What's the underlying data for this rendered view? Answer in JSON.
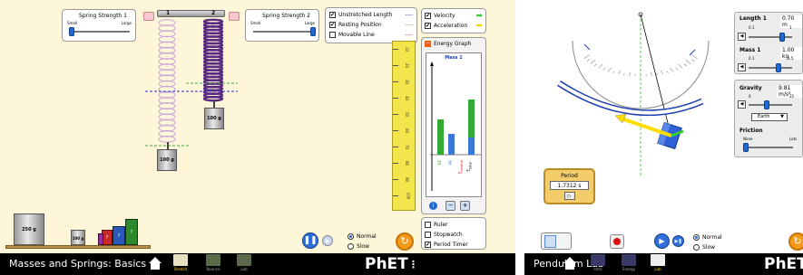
{
  "left_sim": {
    "title": "Masses and Springs: Basics",
    "spring_strength_1": {
      "label": "Spring Strength 1",
      "min_label": "Small",
      "max_label": "Large"
    },
    "spring_strength_2": {
      "label": "Spring Strength 2",
      "min_label": "Small",
      "max_label": "Large"
    },
    "spring_numbers": [
      "1",
      "2"
    ],
    "options": [
      {
        "label": "Unstretched Length",
        "checked": true
      },
      {
        "label": "Resting Position",
        "checked": true
      },
      {
        "label": "Movable Line",
        "checked": false
      }
    ],
    "attached_masses": [
      "100 g",
      "100 g"
    ],
    "shelf_masses": [
      "250 g",
      "100 g",
      "?",
      "?",
      "?",
      "?",
      "?"
    ],
    "ruler_marks": [
      "10",
      "20",
      "30",
      "40",
      "50",
      "60",
      "70",
      "80",
      "90",
      "100"
    ],
    "speed": {
      "normal": "Normal",
      "slow": "Slow",
      "selected": "Normal"
    },
    "screens": [
      "Stretch",
      "Bounce",
      "Lab"
    ],
    "active_screen": "Stretch",
    "brand": "PhET"
  },
  "middle_panel": {
    "vectors": [
      {
        "label": "Velocity",
        "checked": true,
        "arrow_color": "#33cc33"
      },
      {
        "label": "Acceleration",
        "checked": true,
        "arrow_color": "#ffee00"
      }
    ],
    "energy_graph": {
      "title": "Energy Graph",
      "graph_title": "Mass 1",
      "bar_labels": [
        "KE",
        "PE",
        "E",
        "E"
      ],
      "bar_subscripts": [
        "",
        "",
        "thermal",
        "total"
      ],
      "bar_colors": [
        "#33aa33",
        "#3a78d8",
        "#e03030",
        "#33aa33"
      ]
    },
    "tools": [
      {
        "label": "Ruler",
        "checked": false
      },
      {
        "label": "Stopwatch",
        "checked": false
      },
      {
        "label": "Period Timer",
        "checked": true
      }
    ]
  },
  "right_sim": {
    "title": "Pendulum Lab",
    "length": {
      "label": "Length 1",
      "value": "0.70 m",
      "min": "0.1",
      "max": "1"
    },
    "mass": {
      "label": "Mass 1",
      "value": "1.00 kg",
      "min": "0.1",
      "max": "1.5"
    },
    "gravity": {
      "label": "Gravity",
      "value": "9.81 m/s²",
      "min": "0",
      "max": "25",
      "planet": "Earth"
    },
    "friction": {
      "label": "Friction",
      "min_label": "None",
      "max_label": "Lots"
    },
    "period": {
      "label": "Period",
      "value": "1.7312 s"
    },
    "speed": {
      "normal": "Normal",
      "slow": "Slow",
      "selected": "Normal"
    },
    "screens": [
      "Intro",
      "Energy",
      "Lab"
    ],
    "active_screen": "Lab",
    "brand": "PhET",
    "colors": {
      "pendulum": "#2f5fd6",
      "velocity_arrow": "#ffdd00",
      "acceleration_arrow": "#33cc33",
      "arc": "#1e3fb0"
    }
  }
}
